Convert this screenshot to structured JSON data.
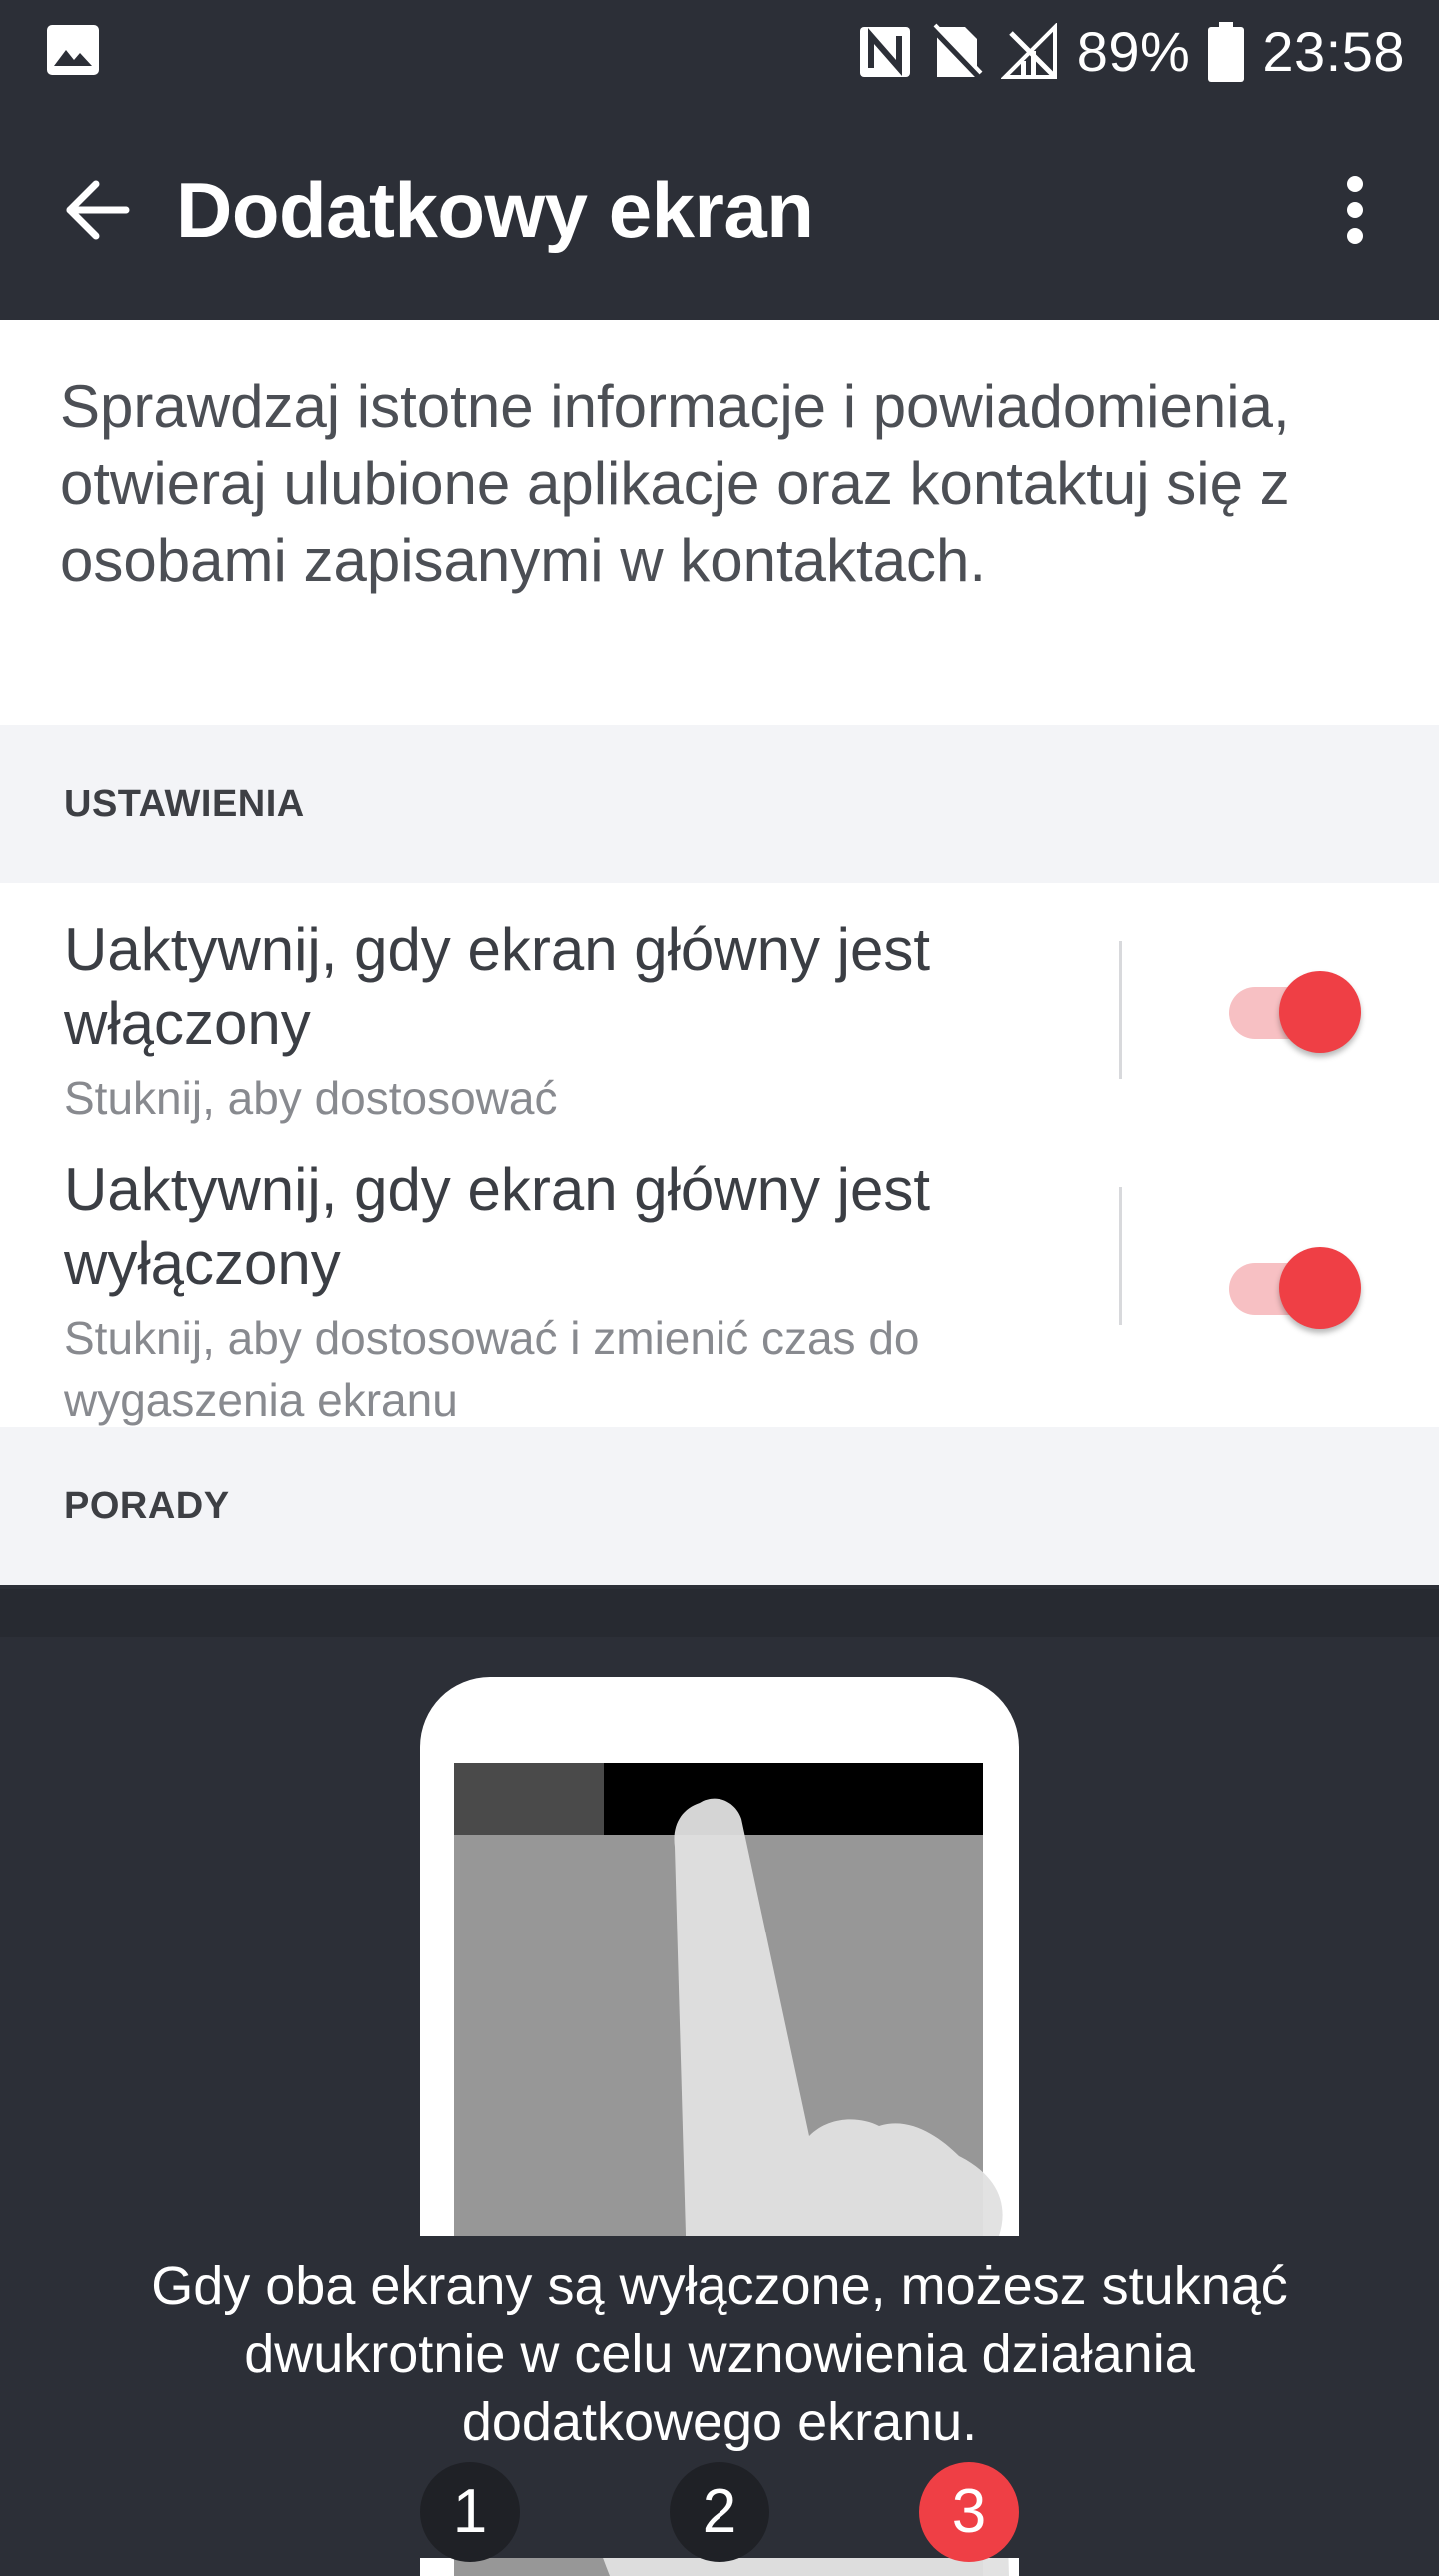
{
  "status_bar": {
    "battery_percent": "89%",
    "time": "23:58",
    "icons": [
      "image-notification-icon",
      "nfc-icon",
      "no-sim-icon",
      "signal-off-icon",
      "battery-icon"
    ]
  },
  "app_bar": {
    "title": "Dodatkowy ekran",
    "back_icon": "arrow-back-icon",
    "menu_icon": "more-vert-icon"
  },
  "description": "Sprawdzaj istotne informacje i powiadomienia, otwieraj ulubione aplikacje oraz kontaktuj się z osobami zapisanymi w kontaktach.",
  "settings_section": {
    "header": "USTAWIENIA",
    "items": [
      {
        "title": "Uaktywnij, gdy ekran główny jest włączony",
        "subtitle": "Stuknij, aby dostosować",
        "enabled": true
      },
      {
        "title": "Uaktywnij, gdy ekran główny jest wyłączony",
        "subtitle": "Stuknij, aby dostosować i zmienić czas do wygaszenia ekranu",
        "enabled": true
      }
    ]
  },
  "tips_section": {
    "header": "PORADY",
    "tip_text": "Gdy oba ekrany są wyłączone, możesz stuknąć dwukrotnie w celu wznowienia działania dodatkowego ekranu.",
    "pages": [
      "1",
      "2",
      "3"
    ],
    "active_page": "3"
  },
  "colors": {
    "dark_bg": "#2c2f37",
    "accent": "#ef3f45",
    "toggle_track": "#f7c0c3",
    "section_bg": "#f3f4f7"
  }
}
